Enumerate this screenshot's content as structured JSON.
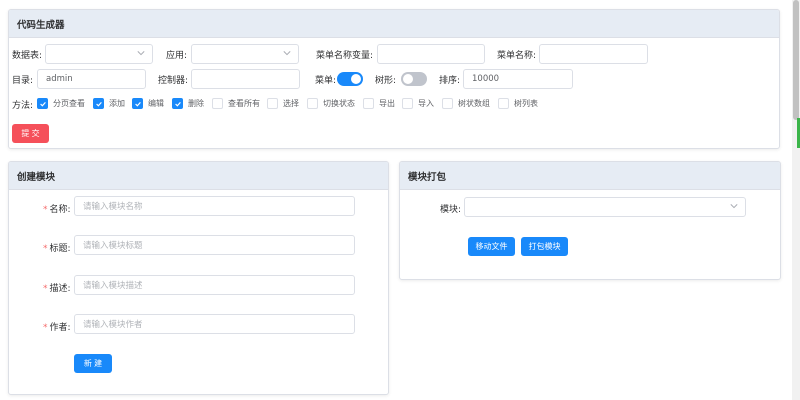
{
  "generator": {
    "title": "代码生成器",
    "table_label": "数据表:",
    "app_label": "应用:",
    "menu_var_label": "菜单名称变量:",
    "menu_name_label": "菜单名称:",
    "dir_label": "目录:",
    "dir_value": "admin",
    "controller_label": "控制器:",
    "menu_label": "菜单:",
    "tree_label": "树形:",
    "sort_label": "排序:",
    "sort_value": "10000",
    "method_label": "方法:",
    "methods": [
      {
        "label": "分页查看",
        "checked": true
      },
      {
        "label": "添加",
        "checked": true
      },
      {
        "label": "编辑",
        "checked": true
      },
      {
        "label": "删除",
        "checked": true
      },
      {
        "label": "查看所有",
        "checked": false
      },
      {
        "label": "选择",
        "checked": false
      },
      {
        "label": "切换状态",
        "checked": false
      },
      {
        "label": "导出",
        "checked": false
      },
      {
        "label": "导入",
        "checked": false
      },
      {
        "label": "树状数组",
        "checked": false
      },
      {
        "label": "树列表",
        "checked": false
      }
    ],
    "submit_label": "提 交"
  },
  "create_module": {
    "title": "创建模块",
    "name_label": "名称:",
    "name_placeholder": "请输入模块名称",
    "title_label": "标题:",
    "title_placeholder": "请输入模块标题",
    "desc_label": "描述:",
    "desc_placeholder": "请输入模块描述",
    "author_label": "作者:",
    "author_placeholder": "请输入模块作者",
    "create_label": "新 建",
    "required_mark": "*"
  },
  "package_module": {
    "title": "模块打包",
    "module_label": "模块:",
    "move_label": "移动文件",
    "pack_label": "打包模块"
  },
  "colors": {
    "primary": "#1989fa",
    "danger": "#f5505a",
    "header_bg": "#e6ecf4"
  }
}
